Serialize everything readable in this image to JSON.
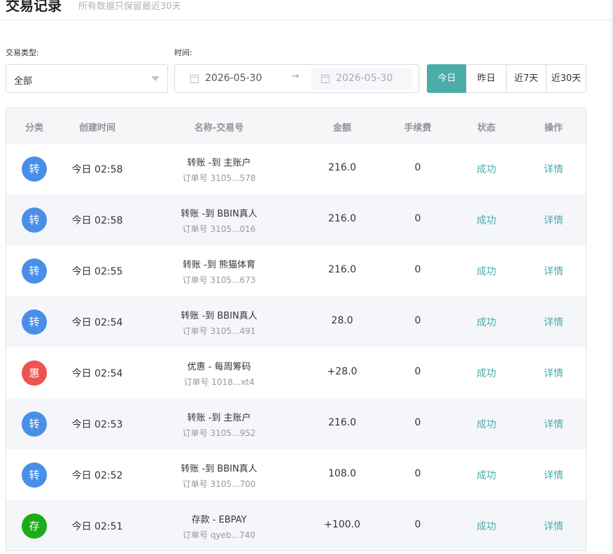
{
  "header": {
    "title": "交易记录",
    "subtitle": "所有数据只保留最近30天"
  },
  "filters": {
    "type_label": "交易类型:",
    "type_value": "全部",
    "time_label": "时间:",
    "start_date": "2026-05-30",
    "range_separator": "→",
    "end_date": "2026-05-30",
    "quick_ranges": [
      "今日",
      "昨日",
      "近7天",
      "近30天"
    ],
    "active_range": "今日"
  },
  "table": {
    "headers": [
      "分类",
      "创建时间",
      "名称-交易号",
      "金额",
      "手续费",
      "状态",
      "操作"
    ],
    "rows": [
      {
        "badge": "转",
        "badge_color": "#4a8fe7",
        "time": "今日 02:58",
        "name": "转账 -到 主账户",
        "order": "订单号 3105...578",
        "amount": "216.0",
        "fee": "0",
        "status": "成功",
        "action": "详情"
      },
      {
        "badge": "转",
        "badge_color": "#4a8fe7",
        "time": "今日 02:58",
        "name": "转账 -到 BBIN真人",
        "order": "订单号 3105...016",
        "amount": "216.0",
        "fee": "0",
        "status": "成功",
        "action": "详情"
      },
      {
        "badge": "转",
        "badge_color": "#4a8fe7",
        "time": "今日 02:55",
        "name": "转账 -到 熊猫体育",
        "order": "订单号 3105...673",
        "amount": "216.0",
        "fee": "0",
        "status": "成功",
        "action": "详情"
      },
      {
        "badge": "转",
        "badge_color": "#4a8fe7",
        "time": "今日 02:54",
        "name": "转账 -到 BBIN真人",
        "order": "订单号 3105...491",
        "amount": "28.0",
        "fee": "0",
        "status": "成功",
        "action": "详情"
      },
      {
        "badge": "惠",
        "badge_color": "#ef5350",
        "time": "今日 02:54",
        "name": "优惠 - 每周筹码",
        "order": "订单号 1018...xt4",
        "amount": "+28.0",
        "fee": "0",
        "status": "成功",
        "action": "详情"
      },
      {
        "badge": "转",
        "badge_color": "#4a8fe7",
        "time": "今日 02:53",
        "name": "转账 -到 主账户",
        "order": "订单号 3105...952",
        "amount": "216.0",
        "fee": "0",
        "status": "成功",
        "action": "详情"
      },
      {
        "badge": "转",
        "badge_color": "#4a8fe7",
        "time": "今日 02:52",
        "name": "转账 -到 BBIN真人",
        "order": "订单号 3105...700",
        "amount": "108.0",
        "fee": "0",
        "status": "成功",
        "action": "详情"
      },
      {
        "badge": "存",
        "badge_color": "#1aad19",
        "time": "今日 02:51",
        "name": "存款 - EBPAY",
        "order": "订单号 qyeb...740",
        "amount": "+100.0",
        "fee": "0",
        "status": "成功",
        "action": "详情"
      }
    ]
  },
  "colors": {
    "accent": "#4aada8",
    "transfer": "#4a8fe7",
    "promo": "#ef5350",
    "deposit": "#1aad19"
  }
}
